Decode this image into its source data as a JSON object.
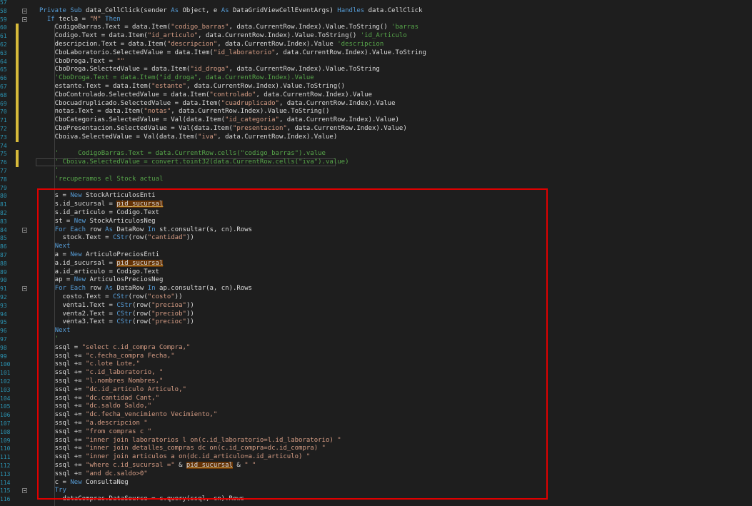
{
  "editor": {
    "lines": [
      {
        "n": "57",
        "tokens": []
      },
      {
        "n": "58",
        "fold": true,
        "tokens": [
          [
            "kw",
            "Private Sub "
          ],
          [
            "",
            "data_CellClick(sender "
          ],
          [
            "kw",
            "As "
          ],
          [
            "",
            "Object, e "
          ],
          [
            "kw",
            "As "
          ],
          [
            "",
            "DataGridViewCellEventArgs) "
          ],
          [
            "kw",
            "Handles "
          ],
          [
            "",
            "data.CellClick"
          ]
        ]
      },
      {
        "n": "59",
        "fold": true,
        "tokens": [
          [
            "",
            "  "
          ],
          [
            "kw",
            "If "
          ],
          [
            "",
            "tecla = "
          ],
          [
            "st",
            "\"M\" "
          ],
          [
            "kw",
            "Then"
          ]
        ]
      },
      {
        "n": "60",
        "mod": true,
        "tokens": [
          [
            "",
            "    CodigoBarras.Text = data.Item("
          ],
          [
            "st",
            "\"codigo_barras\""
          ],
          [
            "",
            ", data.CurrentRow.Index).Value.ToString() "
          ],
          [
            "cm",
            "'barras"
          ]
        ]
      },
      {
        "n": "61",
        "mod": true,
        "tokens": [
          [
            "",
            "    Codigo.Text = data.Item("
          ],
          [
            "st",
            "\"id_articulo\""
          ],
          [
            "",
            ", data.CurrentRow.Index).Value.ToString() "
          ],
          [
            "cm",
            "'id_Articulo"
          ]
        ]
      },
      {
        "n": "62",
        "mod": true,
        "tokens": [
          [
            "",
            "    descripcion.Text = data.Item("
          ],
          [
            "st",
            "\"descripcion\""
          ],
          [
            "",
            ", data.CurrentRow.Index).Value "
          ],
          [
            "cm",
            "'descripcion"
          ]
        ]
      },
      {
        "n": "63",
        "mod": true,
        "tokens": [
          [
            "",
            "    CboLaboratorio.SelectedValue = data.Item("
          ],
          [
            "st",
            "\"id_laboratorio\""
          ],
          [
            "",
            ", data.CurrentRow.Index).Value.ToString"
          ]
        ]
      },
      {
        "n": "64",
        "mod": true,
        "tokens": [
          [
            "",
            "    CboDroga.Text = "
          ],
          [
            "st",
            "\"\""
          ]
        ]
      },
      {
        "n": "65",
        "mod": true,
        "tokens": [
          [
            "",
            "    CboDroga.SelectedValue = data.Item("
          ],
          [
            "st",
            "\"id_droga\""
          ],
          [
            "",
            ", data.CurrentRow.Index).Value.ToString"
          ]
        ]
      },
      {
        "n": "66",
        "mod": true,
        "tokens": [
          [
            "",
            "    "
          ],
          [
            "cm",
            "'CboDroga.Text = data.Item(\"id_droga\", data.CurrentRow.Index).Value"
          ]
        ]
      },
      {
        "n": "67",
        "mod": true,
        "tokens": [
          [
            "",
            "    estante.Text = data.Item("
          ],
          [
            "st",
            "\"estante\""
          ],
          [
            "",
            ", data.CurrentRow.Index).Value.ToString()"
          ]
        ]
      },
      {
        "n": "68",
        "mod": true,
        "tokens": [
          [
            "",
            "    CboControlado.SelectedValue = data.Item("
          ],
          [
            "st",
            "\"controlado\""
          ],
          [
            "",
            ", data.CurrentRow.Index).Value"
          ]
        ]
      },
      {
        "n": "69",
        "mod": true,
        "tokens": [
          [
            "",
            "    Cbocuadruplicado.SelectedValue = data.Item("
          ],
          [
            "st",
            "\"cuadruplicado\""
          ],
          [
            "",
            ", data.CurrentRow.Index).Value"
          ]
        ]
      },
      {
        "n": "70",
        "mod": true,
        "tokens": [
          [
            "",
            "    notas.Text = data.Item("
          ],
          [
            "st",
            "\"notas\""
          ],
          [
            "",
            ", data.CurrentRow.Index).Value.ToString()"
          ]
        ]
      },
      {
        "n": "71",
        "mod": true,
        "tokens": [
          [
            "",
            "    CboCategorias.SelectedValue = Val(data.Item("
          ],
          [
            "st",
            "\"id_categoria\""
          ],
          [
            "",
            ", data.CurrentRow.Index).Value)"
          ]
        ]
      },
      {
        "n": "72",
        "mod": true,
        "tokens": [
          [
            "",
            "    CboPresentacion.SelectedValue = Val(data.Item("
          ],
          [
            "st",
            "\"presentacion\""
          ],
          [
            "",
            ", data.CurrentRow.Index).Value)"
          ]
        ]
      },
      {
        "n": "73",
        "mod": true,
        "tokens": [
          [
            "",
            "    Cboiva.SelectedValue = Val(data.Item("
          ],
          [
            "st",
            "\"iva\""
          ],
          [
            "",
            ", data.CurrentRow.Index).Value)"
          ]
        ]
      },
      {
        "n": "74",
        "tokens": []
      },
      {
        "n": "75",
        "mod": true,
        "tokens": [
          [
            "",
            "    "
          ],
          [
            "cm",
            "'     CodigoBarras.Text = data.CurrentRow.cells(\"codigo_barras\").value"
          ]
        ]
      },
      {
        "n": "76",
        "mod": true,
        "current": true,
        "tokens": [
          [
            "",
            "    "
          ],
          [
            "cm",
            "' Cboiva.SelectedValue = convert.toint32(data.CurrentRow.cells(\"iva\").value)"
          ]
        ]
      },
      {
        "n": "77",
        "tokens": [
          [
            "",
            "    "
          ],
          [
            "cm",
            "'"
          ]
        ]
      },
      {
        "n": "78",
        "tokens": [
          [
            "",
            "    "
          ],
          [
            "cm",
            "'recuperamos el Stock actual"
          ]
        ]
      },
      {
        "n": "79",
        "tokens": []
      },
      {
        "n": "80",
        "tokens": [
          [
            "",
            "    s = "
          ],
          [
            "kw",
            "New "
          ],
          [
            "ty",
            "StockArticulosEnti"
          ]
        ]
      },
      {
        "n": "81",
        "tokens": [
          [
            "",
            "    s.id_sucursal = "
          ],
          [
            "hl",
            "pid_sucursal"
          ]
        ]
      },
      {
        "n": "82",
        "tokens": [
          [
            "",
            "    s.id_articulo = Codigo.Text"
          ]
        ]
      },
      {
        "n": "83",
        "tokens": [
          [
            "",
            "    st = "
          ],
          [
            "kw",
            "New "
          ],
          [
            "ty",
            "StockArticulosNeg"
          ]
        ]
      },
      {
        "n": "84",
        "fold": true,
        "tokens": [
          [
            "",
            "    "
          ],
          [
            "kw",
            "For Each "
          ],
          [
            "",
            "row "
          ],
          [
            "kw",
            "As "
          ],
          [
            "",
            "DataRow "
          ],
          [
            "kw",
            "In "
          ],
          [
            "",
            "st.consultar(s, cn).Rows"
          ]
        ]
      },
      {
        "n": "85",
        "tokens": [
          [
            "",
            "      stock.Text = "
          ],
          [
            "kw",
            "CStr"
          ],
          [
            "",
            "(row("
          ],
          [
            "st",
            "\"cantidad\""
          ],
          [
            "",
            "))"
          ]
        ]
      },
      {
        "n": "86",
        "tokens": [
          [
            "",
            "    "
          ],
          [
            "kw",
            "Next"
          ]
        ]
      },
      {
        "n": "87",
        "tokens": [
          [
            "",
            "    a = "
          ],
          [
            "kw",
            "New "
          ],
          [
            "ty",
            "ArticuloPreciosEnti"
          ]
        ]
      },
      {
        "n": "88",
        "tokens": [
          [
            "",
            "    a.id_sucursal = "
          ],
          [
            "hl",
            "pid_sucursal"
          ]
        ]
      },
      {
        "n": "89",
        "tokens": [
          [
            "",
            "    a.id_articulo = Codigo.Text"
          ]
        ]
      },
      {
        "n": "90",
        "tokens": [
          [
            "",
            "    ap = "
          ],
          [
            "kw",
            "New "
          ],
          [
            "ty",
            "ArticulosPreciosNeg"
          ]
        ]
      },
      {
        "n": "91",
        "fold": true,
        "tokens": [
          [
            "",
            "    "
          ],
          [
            "kw",
            "For Each "
          ],
          [
            "",
            "row "
          ],
          [
            "kw",
            "As "
          ],
          [
            "",
            "DataRow "
          ],
          [
            "kw",
            "In "
          ],
          [
            "",
            "ap.consultar(a, cn).Rows"
          ]
        ]
      },
      {
        "n": "92",
        "tokens": [
          [
            "",
            "      costo.Text = "
          ],
          [
            "kw",
            "CStr"
          ],
          [
            "",
            "(row("
          ],
          [
            "st",
            "\"costo\""
          ],
          [
            "",
            "))"
          ]
        ]
      },
      {
        "n": "93",
        "tokens": [
          [
            "",
            "      venta1.Text = "
          ],
          [
            "kw",
            "CStr"
          ],
          [
            "",
            "(row("
          ],
          [
            "st",
            "\"precioa\""
          ],
          [
            "",
            "))"
          ]
        ]
      },
      {
        "n": "94",
        "tokens": [
          [
            "",
            "      venta2.Text = "
          ],
          [
            "kw",
            "CStr"
          ],
          [
            "",
            "(row("
          ],
          [
            "st",
            "\"preciob\""
          ],
          [
            "",
            "))"
          ]
        ]
      },
      {
        "n": "95",
        "tokens": [
          [
            "",
            "      venta3.Text = "
          ],
          [
            "kw",
            "CStr"
          ],
          [
            "",
            "(row("
          ],
          [
            "st",
            "\"precioc\""
          ],
          [
            "",
            "))"
          ]
        ]
      },
      {
        "n": "96",
        "tokens": [
          [
            "",
            "    "
          ],
          [
            "kw",
            "Next"
          ]
        ]
      },
      {
        "n": "97",
        "tokens": [
          [
            "",
            "    "
          ],
          [
            "cm",
            "'"
          ]
        ]
      },
      {
        "n": "98",
        "tokens": [
          [
            "",
            "    ssql = "
          ],
          [
            "st",
            "\"select c.id_compra Compra,\""
          ]
        ]
      },
      {
        "n": "99",
        "tokens": [
          [
            "",
            "    ssql += "
          ],
          [
            "st",
            "\"c.fecha_compra Fecha,\""
          ]
        ]
      },
      {
        "n": "100",
        "tokens": [
          [
            "",
            "    ssql += "
          ],
          [
            "st",
            "\"c.lote Lote,\""
          ]
        ]
      },
      {
        "n": "101",
        "tokens": [
          [
            "",
            "    ssql += "
          ],
          [
            "st",
            "\"c.id_laboratorio, \""
          ]
        ]
      },
      {
        "n": "102",
        "tokens": [
          [
            "",
            "    ssql += "
          ],
          [
            "st",
            "\"l.nombres Nombres,\""
          ]
        ]
      },
      {
        "n": "103",
        "tokens": [
          [
            "",
            "    ssql += "
          ],
          [
            "st",
            "\"dc.id_articulo Articulo,\""
          ]
        ]
      },
      {
        "n": "104",
        "tokens": [
          [
            "",
            "    ssql += "
          ],
          [
            "st",
            "\"dc.cantidad Cant,\""
          ]
        ]
      },
      {
        "n": "105",
        "tokens": [
          [
            "",
            "    ssql += "
          ],
          [
            "st",
            "\"dc.saldo Saldo,\""
          ]
        ]
      },
      {
        "n": "106",
        "tokens": [
          [
            "",
            "    ssql += "
          ],
          [
            "st",
            "\"dc.fecha_vencimiento Vecimiento,\""
          ]
        ]
      },
      {
        "n": "107",
        "tokens": [
          [
            "",
            "    ssql += "
          ],
          [
            "st",
            "\"a.descripcion \""
          ]
        ]
      },
      {
        "n": "108",
        "tokens": [
          [
            "",
            "    ssql += "
          ],
          [
            "st",
            "\"from compras c \""
          ]
        ]
      },
      {
        "n": "109",
        "tokens": [
          [
            "",
            "    ssql += "
          ],
          [
            "st",
            "\"inner join laboratorios l on(c.id_laboratorio=l.id_laboratorio) \""
          ]
        ]
      },
      {
        "n": "110",
        "tokens": [
          [
            "",
            "    ssql += "
          ],
          [
            "st",
            "\"inner join detalles_compras dc on(c.id_compra=dc.id_compra) \""
          ]
        ]
      },
      {
        "n": "111",
        "tokens": [
          [
            "",
            "    ssql += "
          ],
          [
            "st",
            "\"inner join articulos a on(dc.id_articulo=a.id_articulo) \""
          ]
        ]
      },
      {
        "n": "112",
        "tokens": [
          [
            "",
            "    ssql += "
          ],
          [
            "st",
            "\"where c.id_sucursal =\" "
          ],
          [
            "",
            "& "
          ],
          [
            "hl",
            "pid_sucursal"
          ],
          [
            "",
            " & "
          ],
          [
            "st",
            "\" \""
          ]
        ]
      },
      {
        "n": "113",
        "tokens": [
          [
            "",
            "    ssql += "
          ],
          [
            "st",
            "\"and dc.saldo>0\""
          ]
        ]
      },
      {
        "n": "114",
        "tokens": [
          [
            "",
            "    c = "
          ],
          [
            "kw",
            "New "
          ],
          [
            "ty",
            "ConsultaNeg"
          ]
        ]
      },
      {
        "n": "115",
        "fold": true,
        "tokens": [
          [
            "",
            "    "
          ],
          [
            "kw",
            "Try"
          ]
        ]
      },
      {
        "n": "116",
        "tokens": [
          [
            "",
            "      dataCompras.DataSource = c.query(ssql, cn).Rows"
          ]
        ]
      }
    ]
  }
}
